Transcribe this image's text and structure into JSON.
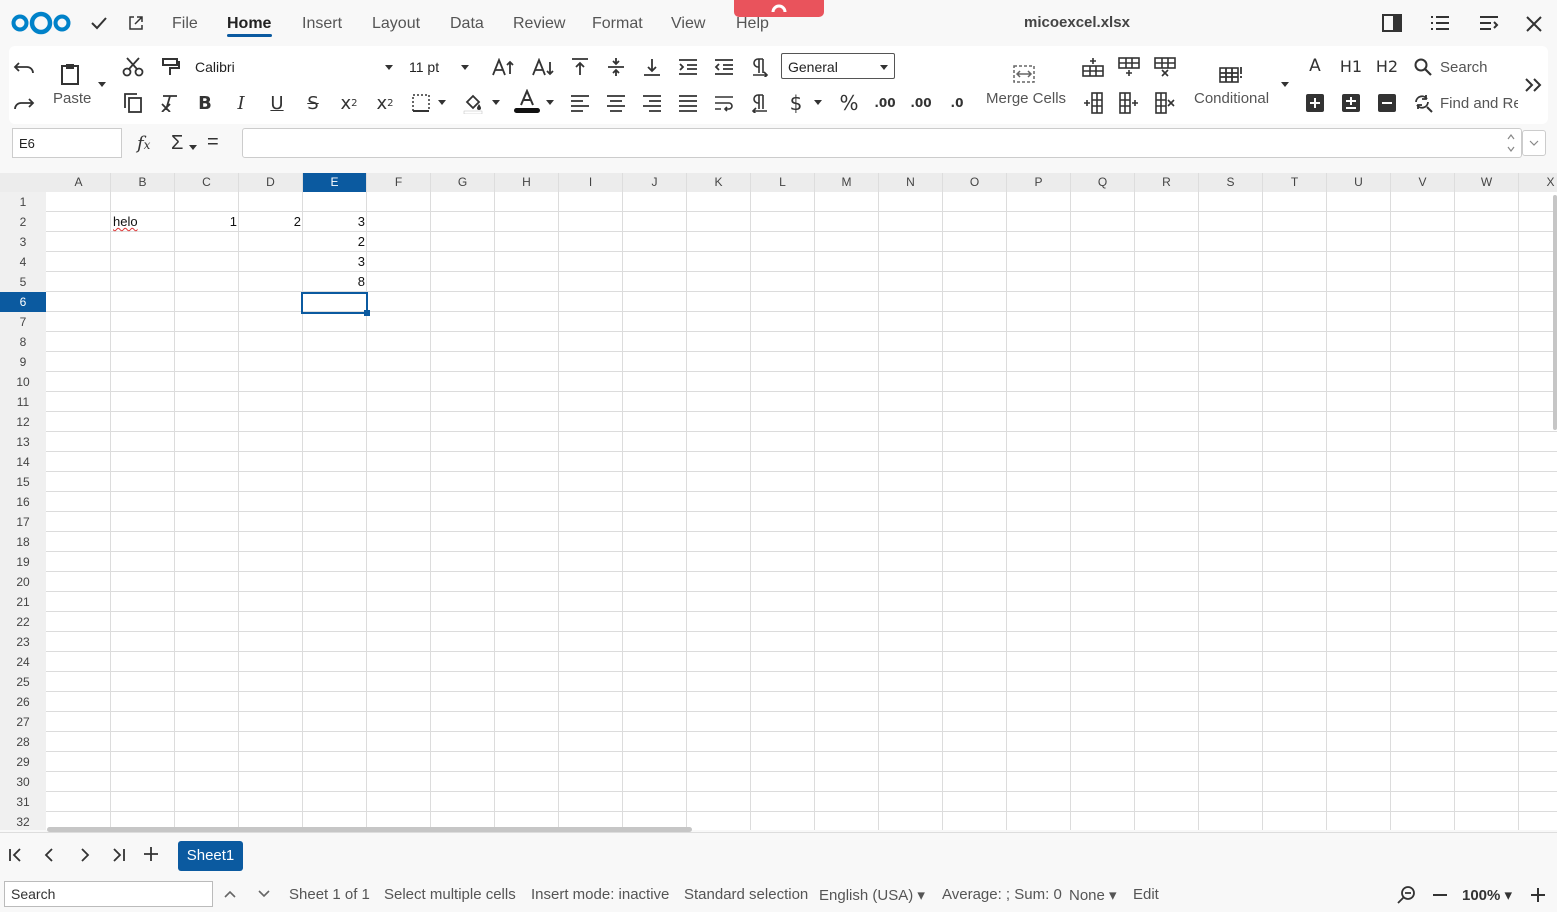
{
  "menubar": {
    "items": [
      "File",
      "Home",
      "Insert",
      "Layout",
      "Data",
      "Review",
      "Format",
      "View",
      "Help"
    ],
    "active": "Home",
    "document_title": "micoexcel.xlsx"
  },
  "toolbar": {
    "paste_label": "Paste",
    "font_name": "Calibri",
    "font_size": "11 pt",
    "number_format": "General",
    "merge_cells_label": "Merge Cells",
    "conditional_label": "Conditional",
    "h1_label": "H1",
    "h2_label": "H2",
    "a_label": "A",
    "search_label": "Search",
    "find_replace_label": "Find and Re",
    "decimal_add_label": ".00",
    "decimal_label": ".00",
    "decimal_remove_label": ".0"
  },
  "formula_bar": {
    "name_box": "E6",
    "formula": ""
  },
  "sheet": {
    "columns": [
      "A",
      "B",
      "C",
      "D",
      "E",
      "F",
      "G",
      "H",
      "I",
      "J",
      "K",
      "L",
      "M",
      "N",
      "O",
      "P",
      "Q",
      "R",
      "S",
      "T",
      "U",
      "V",
      "W",
      "X"
    ],
    "selected_column": "E",
    "row_count": 32,
    "selected_row": 6,
    "cells": {
      "B2": "helo",
      "C2": "1",
      "D2": "2",
      "E2": "3",
      "E3": "2",
      "E4": "3",
      "E5": "8"
    }
  },
  "tabs": {
    "sheets": [
      "Sheet1"
    ],
    "active": "Sheet1"
  },
  "status": {
    "search_placeholder": "Search",
    "sheet_info": "Sheet 1 of 1",
    "selection_mode": "Select multiple cells",
    "insert_mode": "Insert mode: inactive",
    "standard_selection": "Standard selection",
    "language": "English (USA)",
    "summary": "Average: ; Sum: 0",
    "none_label": "None",
    "edit_label": "Edit",
    "zoom": "100%"
  },
  "colors": {
    "accent": "#0b5aa0",
    "handle": "#e9535c",
    "logo": "#0082c9"
  }
}
